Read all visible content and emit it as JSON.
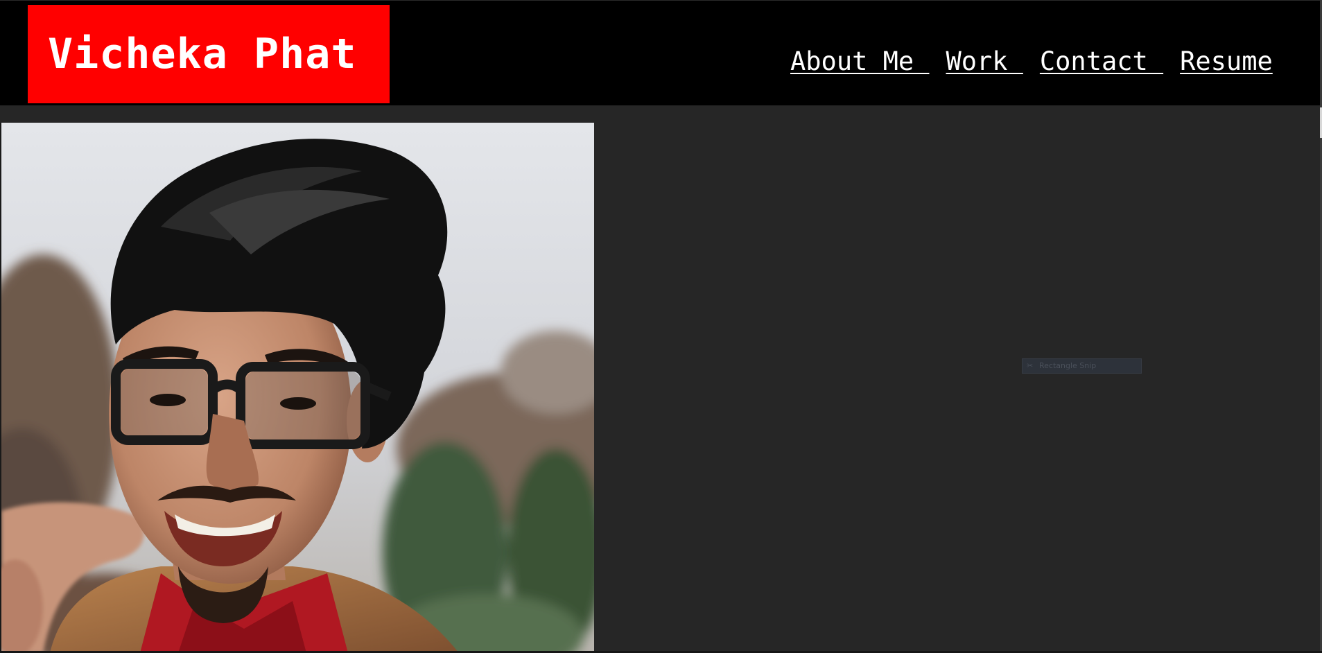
{
  "header": {
    "brand": "Vicheka Phat",
    "brand_color": "#ff0000"
  },
  "nav": {
    "items": [
      {
        "label": "About Me "
      },
      {
        "label": "Work "
      },
      {
        "label": "Contact "
      },
      {
        "label": "Resume"
      }
    ]
  },
  "photo": {
    "alt": "Vicheka Phat"
  },
  "overlay": {
    "snip_label": "Rectangle Snip",
    "snip_icon": "scissors-icon"
  }
}
